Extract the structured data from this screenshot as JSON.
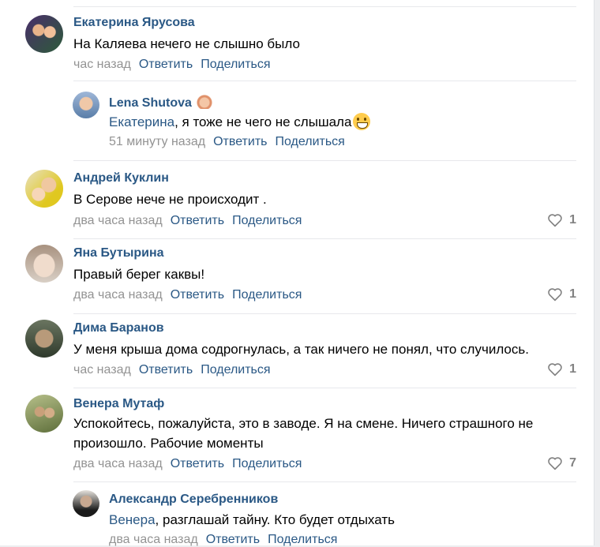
{
  "comments": [
    {
      "author": "Екатерина Ярусова",
      "text": "На Каляева нечего не слышно было",
      "time": "час назад",
      "reply": "Ответить",
      "share": "Поделиться",
      "likes": "",
      "avatar_color": "#5a3a2a"
    },
    {
      "author": "Lena Shutova",
      "reply_to": "Екатерина",
      "text": ", я тоже не чего не слышала",
      "time": "51 минуту назад",
      "reply": "Ответить",
      "share": "Поделиться",
      "likes": "",
      "avatar_color": "#6b8db5"
    },
    {
      "author": "Андрей Куклин",
      "text": "В Серове нече не происходит .",
      "time": "два часа назад",
      "reply": "Ответить",
      "share": "Поделиться",
      "likes": "1",
      "avatar_color": "#d9c13a"
    },
    {
      "author": "Яна Бутырина",
      "text": "Правый берег каквы!",
      "time": "два часа назад",
      "reply": "Ответить",
      "share": "Поделиться",
      "likes": "1",
      "avatar_color": "#c9b7a5"
    },
    {
      "author": "Дима Баранов",
      "text": "У меня крыша дома содрогнулась, а так ничего не понял, что случилось.",
      "time": "час назад",
      "reply": "Ответить",
      "share": "Поделиться",
      "likes": "1",
      "avatar_color": "#3d4a3a"
    },
    {
      "author": "Венера Мутаф",
      "text_line1": "Успокойтесь, пожалуйста, это в заводе. Я на смене. Ничего страшного не",
      "text_line2": "произошло. Рабочие моменты",
      "time": "два часа назад",
      "reply": "Ответить",
      "share": "Поделиться",
      "likes": "7",
      "avatar_color": "#8a9a5a"
    },
    {
      "author": "Александр Серебренников",
      "reply_to": "Венера",
      "text": ", разглашай тайну. Кто будет отдыхать",
      "time": "два часа назад",
      "reply": "Ответить",
      "share": "Поделиться",
      "likes": "",
      "avatar_color": "#2a2a2a"
    }
  ],
  "colors": {
    "link": "#2a5885",
    "meta": "#939393",
    "like": "#828282"
  }
}
